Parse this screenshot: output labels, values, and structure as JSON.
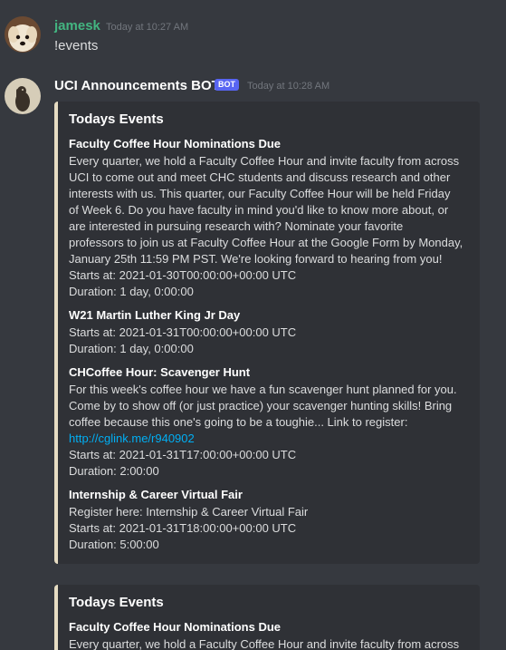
{
  "messages": [
    {
      "username": "jamesk",
      "username_color": "#43b581",
      "timestamp": "Today at 10:27 AM",
      "text": "!events"
    },
    {
      "username": "UCI Announcements BOT",
      "username_color": "#ffffff",
      "bot_tag": "BOT",
      "timestamp": "Today at 10:28 AM",
      "embeds": [
        {
          "title": "Todays Events",
          "fields": [
            {
              "name": "Faculty Coffee Hour Nominations Due",
              "lines": [
                "Every quarter, we hold a Faculty Coffee Hour and invite faculty from across",
                "UCI to come out and meet CHC students and discuss research and other",
                "interests with us. This quarter, our Faculty Coffee Hour will be held Friday",
                "of Week 6. Do you have faculty in mind you'd like to know more about, or",
                "are interested in pursuing research with? Nominate your favorite",
                "professors to join us at Faculty Coffee Hour at the Google Form by Monday,",
                "January 25th 11:59 PM PST. We're looking forward to hearing from you!",
                "Starts at: 2021-01-30T00:00:00+00:00 UTC",
                "Duration: 1 day, 0:00:00"
              ]
            },
            {
              "name": "W21 Martin Luther King Jr Day",
              "lines": [
                "Starts at: 2021-01-31T00:00:00+00:00 UTC",
                "Duration: 1 day, 0:00:00"
              ]
            },
            {
              "name": "CHCoffee Hour: Scavenger Hunt",
              "lines": [
                "For this week's coffee hour we have a fun scavenger hunt planned for you.",
                "Come by to show off (or just practice) your scavenger hunting skills! Bring",
                "coffee because this one's going to be a toughie... Link to register:",
                "http://cglink.me/r940902",
                "Starts at: 2021-01-31T17:00:00+00:00 UTC",
                "Duration: 2:00:00"
              ]
            },
            {
              "name": "Internship & Career Virtual Fair",
              "lines": [
                "Register here: Internship & Career Virtual Fair",
                "Starts at: 2021-01-31T18:00:00+00:00 UTC",
                "Duration: 5:00:00"
              ]
            }
          ]
        },
        {
          "title": "Todays Events",
          "fields": [
            {
              "name": "Faculty Coffee Hour Nominations Due",
              "lines": [
                "Every quarter, we hold a Faculty Coffee Hour and invite faculty from across"
              ]
            }
          ]
        }
      ]
    }
  ],
  "colors": {
    "background": "#36393f",
    "embed_background": "#2f3136",
    "embed_border": "#e6dcc2",
    "link": "#00aff4",
    "bot_tag": "#5865f2"
  }
}
